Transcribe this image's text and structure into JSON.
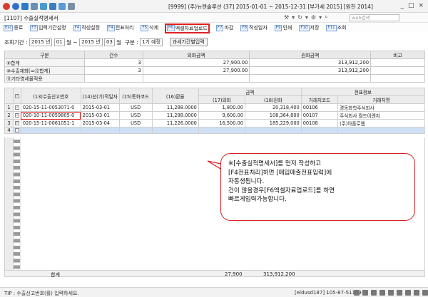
{
  "titlebar": {
    "company": "[9999] (주)뉴젠솔루션 (37] 2015-01-01 ~ 2015-12-31 [부가세 2015] [원천 2014]",
    "window_controls": [
      "_",
      "□",
      "×"
    ]
  },
  "screen": {
    "title": "[1107] 수출실적명세서",
    "search_placeholder": "web검색"
  },
  "fkeys": [
    {
      "key": "Esc",
      "label": "종료"
    },
    {
      "key": "F3",
      "label": "입력기간설정"
    },
    {
      "key": "F4",
      "label": "작성설정"
    },
    {
      "key": "F4",
      "label": "전표처리"
    },
    {
      "key": "F5",
      "label": "삭제"
    },
    {
      "key": "F6",
      "label": "엑셀자료업로드"
    },
    {
      "key": "F7",
      "label": "마감"
    },
    {
      "key": "F8",
      "label": "작성일자"
    },
    {
      "key": "F9",
      "label": "인쇄"
    },
    {
      "key": "F10",
      "label": "저장"
    },
    {
      "key": "F11",
      "label": "조회"
    }
  ],
  "filter": {
    "period_label": "조회기간 :",
    "from_year": "2015 년",
    "from_month": "01",
    "month_word": "월",
    "tilde": "~",
    "to_year": "2015 년",
    "to_month": "03",
    "to_month_word": "월",
    "type_label": "구분 :",
    "type_value": "1기 예정",
    "period_button": "과세기간별입력"
  },
  "summary": {
    "headers": [
      "구분",
      "건수",
      "외화금액",
      "원화금액",
      "비고"
    ],
    "rows": [
      {
        "label": "⑨합계",
        "count": "3",
        "fx": "27,900.00",
        "krw": "313,912,200",
        "note": ""
      },
      {
        "label": "⑩수출재화[=⑫합계]",
        "count": "3",
        "fx": "27,900.00",
        "krw": "313,912,200",
        "note": ""
      },
      {
        "label": "⑪기타영세율적용",
        "count": "",
        "fx": "",
        "krw": "",
        "note": ""
      }
    ]
  },
  "grid": {
    "headers": {
      "no": "",
      "check": "",
      "decl": "(13)수출신고번호",
      "ship": "(14)선(기)적일자",
      "cur": "(15)통화코드",
      "rate": "(16)환율",
      "amount_group": "금액",
      "fx": "(17)외화",
      "krw": "(18)원화",
      "slip_group": "전표정보",
      "client_code": "거래처코드",
      "client_name": "거래처명"
    },
    "rows": [
      {
        "no": "1",
        "check": "✓",
        "decl": "020-15-11-0053071-0",
        "date": "2015-03-01",
        "cur": "USD",
        "rate": "11,288.0000",
        "fx": "1,800.00",
        "krw": "20,318,400",
        "code": "00106",
        "name": "경동화학주식회사"
      },
      {
        "no": "2",
        "check": "✓",
        "decl": "020-10-11-0059805-0",
        "date": "2015-03-01",
        "cur": "USD",
        "rate": "11,288.0000",
        "fx": "9,600.00",
        "krw": "108,364,800",
        "code": "00107",
        "name": "주식회사 월드이엔지"
      },
      {
        "no": "3",
        "check": "✓",
        "decl": "020-15-11-0061051-1",
        "date": "2015-03-04",
        "cur": "USD",
        "rate": "11,226.0000",
        "fx": "16,500.00",
        "krw": "185,229,000",
        "code": "00108",
        "name": "(주)아폴로웹"
      },
      {
        "no": "4",
        "check": "",
        "decl": "",
        "date": "",
        "cur": "",
        "rate": "",
        "fx": "",
        "krw": "",
        "code": "",
        "name": ""
      }
    ],
    "total": {
      "label": "합계",
      "fx": "27,900",
      "krw": "313,912,200"
    }
  },
  "callout": {
    "lines": [
      "※[수출실적명세서]를 먼저 작성하고",
      "[F4전표처리]하면 [매입매출전표입력]에",
      "자동생됩니다.",
      "건이 많을경우[F6엑셀자료업로드]를 하면",
      "빠르게입력가능합니다."
    ]
  },
  "status": {
    "tip": "TIP : 수출신고번호(를) 입력하세요.",
    "user": "[eldusd187] 105-87-51159"
  },
  "colors": {
    "highlight_red": "#e02020",
    "active_row": "#cfe0f5",
    "header_bg": "#ececec"
  }
}
